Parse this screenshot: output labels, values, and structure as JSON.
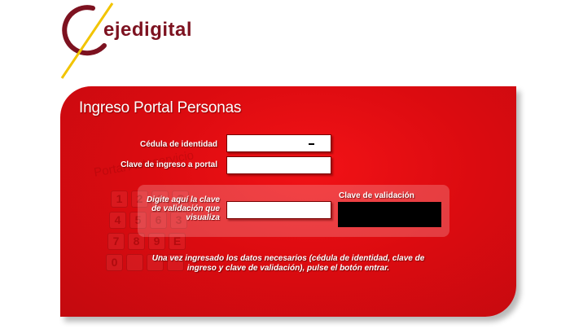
{
  "brand": {
    "logo_text": "ejedigital"
  },
  "panel": {
    "title": "Ingreso Portal Personas",
    "background_watermark": "Portal Autoservicio",
    "keypad_keys": [
      "1",
      "2",
      "3",
      "C",
      "4",
      "5",
      "6",
      "3",
      "7",
      "8",
      "9",
      "E",
      "0",
      "",
      "",
      ""
    ]
  },
  "form": {
    "cedula_label": "Cédula de identidad",
    "cedula_value": "",
    "clave_label": "Clave de ingreso a portal",
    "clave_value": "",
    "validacion_prompt": "Digite aquí la clave de validación que visualiza",
    "validacion_value": "",
    "captcha_label": "Clave de validación"
  },
  "instructions": "Una vez ingresado los datos necesarios (cédula de identidad, clave de ingreso y clave de validación), pulse el botón entrar.",
  "colors": {
    "panel_red": "#dc0b10",
    "logo_dark_red": "#7d1220",
    "logo_yellow": "#f2c400"
  }
}
